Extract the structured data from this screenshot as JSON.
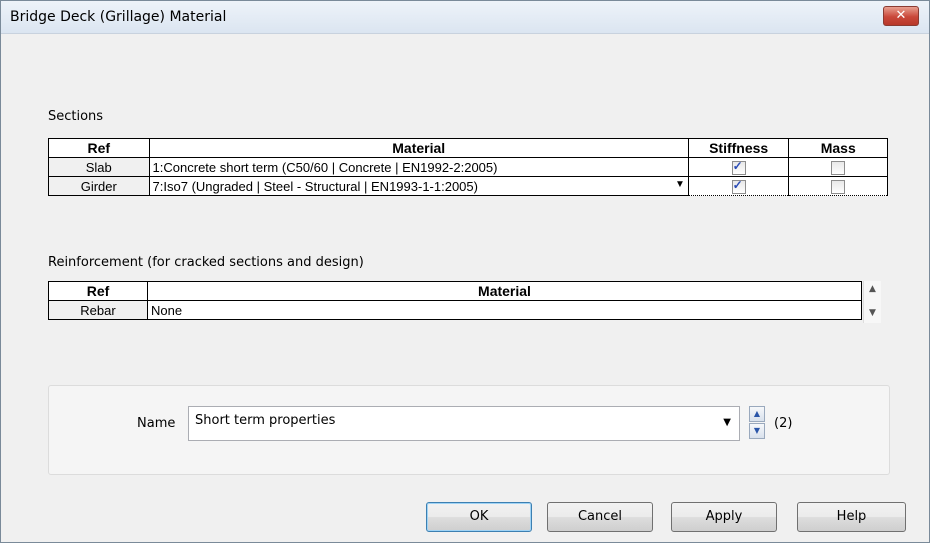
{
  "window": {
    "title": "Bridge Deck (Grillage) Material",
    "close_glyph": "✕"
  },
  "sections": {
    "label": "Sections",
    "headers": {
      "ref": "Ref",
      "material": "Material",
      "stiffness": "Stiffness",
      "mass": "Mass"
    },
    "rows": [
      {
        "ref": "Slab",
        "material": "1:Concrete short term (C50/60 | Concrete | EN1992-2:2005)",
        "stiffness": true,
        "mass": false
      },
      {
        "ref": "Girder",
        "material": "7:Iso7 (Ungraded | Steel - Structural | EN1993-1-1:2005)",
        "stiffness": true,
        "mass": false
      }
    ]
  },
  "reinforcement": {
    "label": "Reinforcement (for cracked sections and design)",
    "headers": {
      "ref": "Ref",
      "material": "Material"
    },
    "rows": [
      {
        "ref": "Rebar",
        "material": "None"
      }
    ]
  },
  "name_field": {
    "label": "Name",
    "value": "Short term properties",
    "count": "(2)"
  },
  "buttons": {
    "ok": "OK",
    "cancel": "Cancel",
    "apply": "Apply",
    "help": "Help"
  },
  "icons": {
    "dropdown": "▼",
    "scroll_up": "▲",
    "scroll_down": "▼"
  }
}
